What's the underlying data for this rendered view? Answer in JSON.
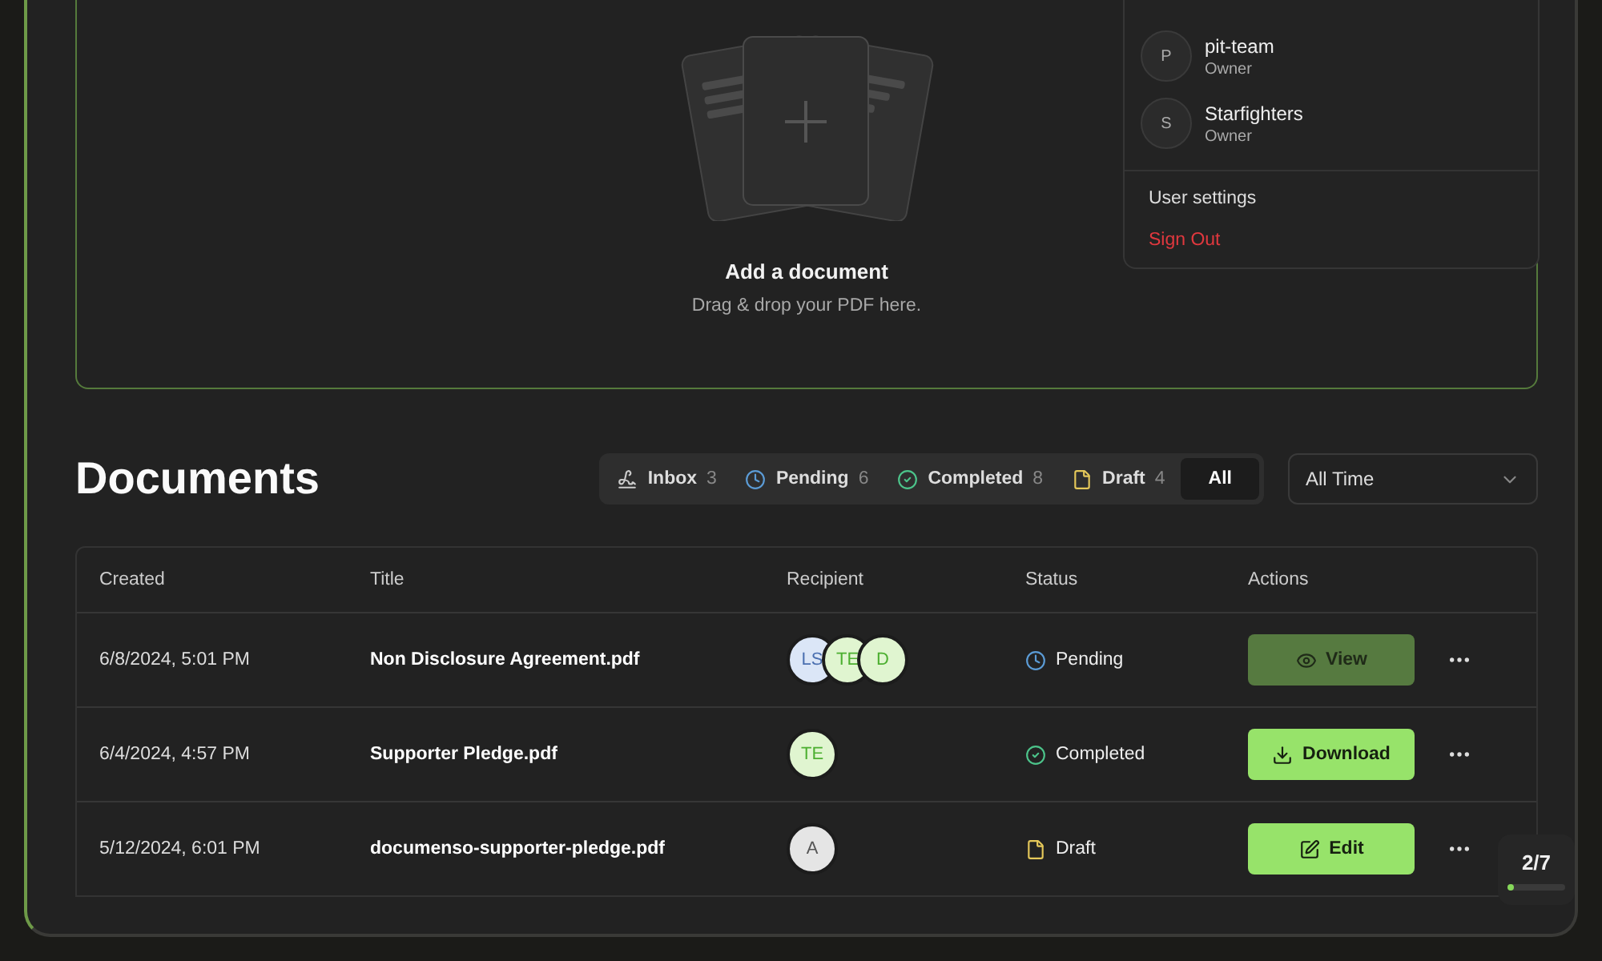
{
  "upload": {
    "title": "Add a document",
    "subtitle": "Drag & drop your PDF here."
  },
  "menu": {
    "teams": [
      {
        "initial": "P",
        "name": "pit-team",
        "role": "Owner"
      },
      {
        "initial": "S",
        "name": "Starfighters",
        "role": "Owner"
      }
    ],
    "items": [
      {
        "label": "User settings",
        "kind": "normal"
      },
      {
        "label": "Sign Out",
        "kind": "danger"
      }
    ]
  },
  "documents": {
    "title": "Documents",
    "filters": [
      {
        "kind": "inbox",
        "label": "Inbox",
        "count": "3",
        "selected": false
      },
      {
        "kind": "pending",
        "label": "Pending",
        "count": "6",
        "selected": false
      },
      {
        "kind": "completed",
        "label": "Completed",
        "count": "8",
        "selected": false
      },
      {
        "kind": "draft",
        "label": "Draft",
        "count": "4",
        "selected": false
      },
      {
        "kind": "all",
        "label": "All",
        "selected": true
      }
    ],
    "period": {
      "value": "All Time"
    }
  },
  "table": {
    "columns": [
      "Created",
      "Title",
      "Recipient",
      "Status",
      "Actions"
    ],
    "rows": [
      {
        "created": "6/8/2024, 5:01 PM",
        "title": "Non Disclosure Agreement.pdf",
        "recipients": [
          {
            "initials": "LS",
            "color": "#dbe6f7"
          },
          {
            "initials": "TE",
            "color": "#e0f5d0"
          },
          {
            "initials": "D",
            "color": "#e0f5d0"
          }
        ],
        "status": {
          "kind": "pending",
          "label": "Pending"
        },
        "action": {
          "kind": "view",
          "label": "View",
          "dimmed": true
        }
      },
      {
        "created": "6/4/2024, 4:57 PM",
        "title": "Supporter Pledge.pdf",
        "recipients": [
          {
            "initials": "TE",
            "color": "#e0f5d0"
          }
        ],
        "status": {
          "kind": "completed",
          "label": "Completed"
        },
        "action": {
          "kind": "download",
          "label": "Download",
          "dimmed": false
        }
      },
      {
        "created": "5/12/2024, 6:01 PM",
        "title": "documenso-supporter-pledge.pdf",
        "recipients": [
          {
            "initials": "A",
            "color": "#e5e5e5"
          }
        ],
        "status": {
          "kind": "draft",
          "label": "Draft"
        },
        "action": {
          "kind": "edit",
          "label": "Edit",
          "dimmed": false
        }
      }
    ]
  },
  "progress": {
    "label": "2/7",
    "level": 0.12
  }
}
